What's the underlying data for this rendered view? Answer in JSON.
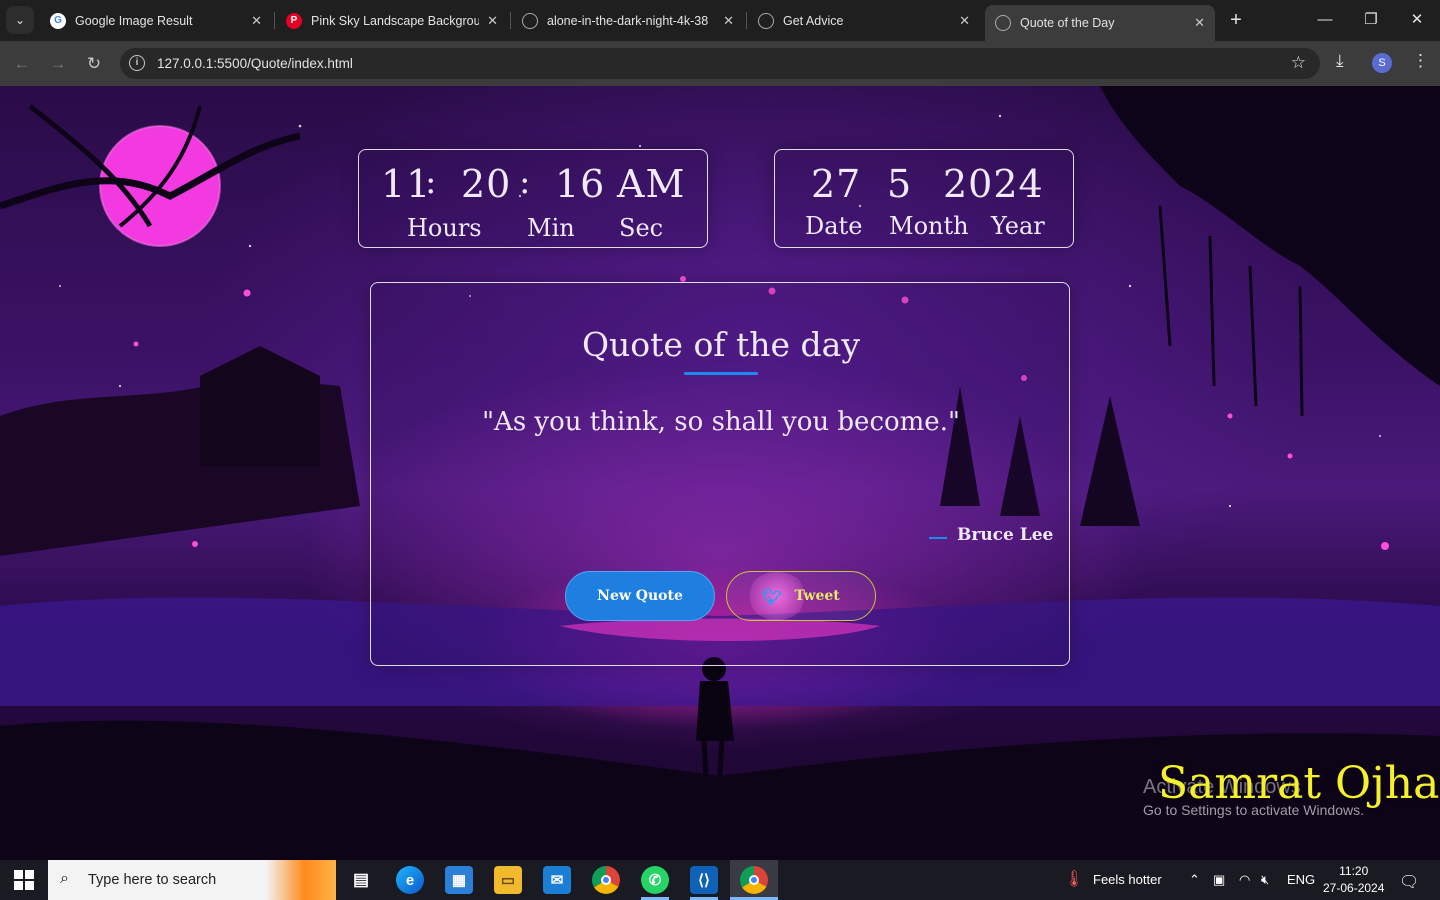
{
  "browser": {
    "tabs": [
      {
        "title": "Google Image Result",
        "icon": "google-icon"
      },
      {
        "title": "Pink Sky Landscape Backgroun",
        "icon": "pinterest-icon"
      },
      {
        "title": "alone-in-the-dark-night-4k-38",
        "icon": "globe-icon"
      },
      {
        "title": "Get Advice",
        "icon": "globe-icon"
      },
      {
        "title": "Quote of the Day",
        "icon": "globe-icon",
        "active": true
      }
    ],
    "url": "127.0.0.1:5500/Quote/index.html",
    "profile_initial": "S"
  },
  "clock": {
    "hours": "11",
    "minutes": "20",
    "seconds": "16",
    "ampm": "AM",
    "hours_label": "Hours",
    "minutes_label": "Min",
    "seconds_label": "Sec"
  },
  "date": {
    "day": "27",
    "month": "5",
    "year": "2024",
    "day_label": "Date",
    "month_label": "Month",
    "year_label": "Year"
  },
  "quote": {
    "title": "Quote of the day",
    "text": "\"As you think, so shall you become.\"",
    "author": "Bruce Lee",
    "new_quote_label": "New Quote",
    "tweet_label": "Tweet"
  },
  "overlay": {
    "signature": "Samrat Ojha",
    "activate_title": "Activate Windows",
    "activate_sub": "Go to Settings to activate Windows."
  },
  "taskbar": {
    "search_placeholder": "Type here to search",
    "weather": "Feels hotter",
    "language": "ENG",
    "time": "11:20",
    "date": "27-06-2024"
  },
  "colors": {
    "accent_blue": "#1f7fe0",
    "tweet_yellow": "#e8e86a",
    "signature_yellow": "#f4f12a",
    "moon_pink": "#f23ae0"
  }
}
